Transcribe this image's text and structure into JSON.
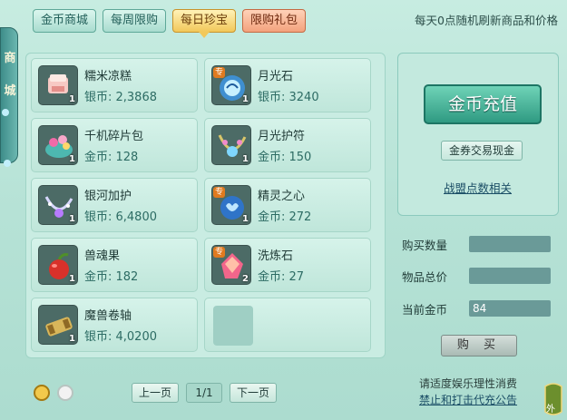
{
  "tabs": [
    {
      "label": "金币商城"
    },
    {
      "label": "每周限购"
    },
    {
      "label": "每日珍宝"
    },
    {
      "label": "限购礼包"
    }
  ],
  "top_note": "每天0点随机刷新商品和价格",
  "side_text": [
    "商",
    "城"
  ],
  "items": [
    {
      "name": "糯米凉糕",
      "price": "银币: 2,3868",
      "qty": "1",
      "special": "",
      "icon": "rice-cake-icon"
    },
    {
      "name": "月光石",
      "price": "银币: 3240",
      "qty": "1",
      "special": "专",
      "icon": "moonstone-icon"
    },
    {
      "name": "千机碎片包",
      "price": "金币: 128",
      "qty": "1",
      "special": "",
      "icon": "fragment-pack-icon"
    },
    {
      "name": "月光护符",
      "price": "金币: 150",
      "qty": "1",
      "special": "",
      "icon": "moon-amulet-icon"
    },
    {
      "name": "银河加护",
      "price": "银币: 6,4800",
      "qty": "1",
      "special": "",
      "icon": "galaxy-necklace-icon"
    },
    {
      "name": "精灵之心",
      "price": "金币: 272",
      "qty": "1",
      "special": "专",
      "icon": "spirit-heart-icon"
    },
    {
      "name": "兽魂果",
      "price": "金币: 182",
      "qty": "1",
      "special": "",
      "icon": "beast-fruit-icon"
    },
    {
      "name": "洗炼石",
      "price": "金币: 27",
      "qty": "2",
      "special": "专",
      "icon": "refine-stone-icon"
    },
    {
      "name": "魔兽卷轴",
      "price": "银币: 4,0200",
      "qty": "1",
      "special": "",
      "icon": "scroll-icon"
    }
  ],
  "pager": {
    "prev": "上一页",
    "page": "1/1",
    "next": "下一页"
  },
  "right": {
    "recharge": "金币充值",
    "exchange": "金券交易现金",
    "alliance": "战盟点数相关",
    "buy_qty_label": "购买数量",
    "total_label": "物品总价",
    "gold_label": "当前金币",
    "gold_value": "84",
    "buy": "购 买"
  },
  "notice": {
    "line1": "请适度娱乐理性消费",
    "line2": "禁止和打击代充公告"
  },
  "corner_label": "外"
}
